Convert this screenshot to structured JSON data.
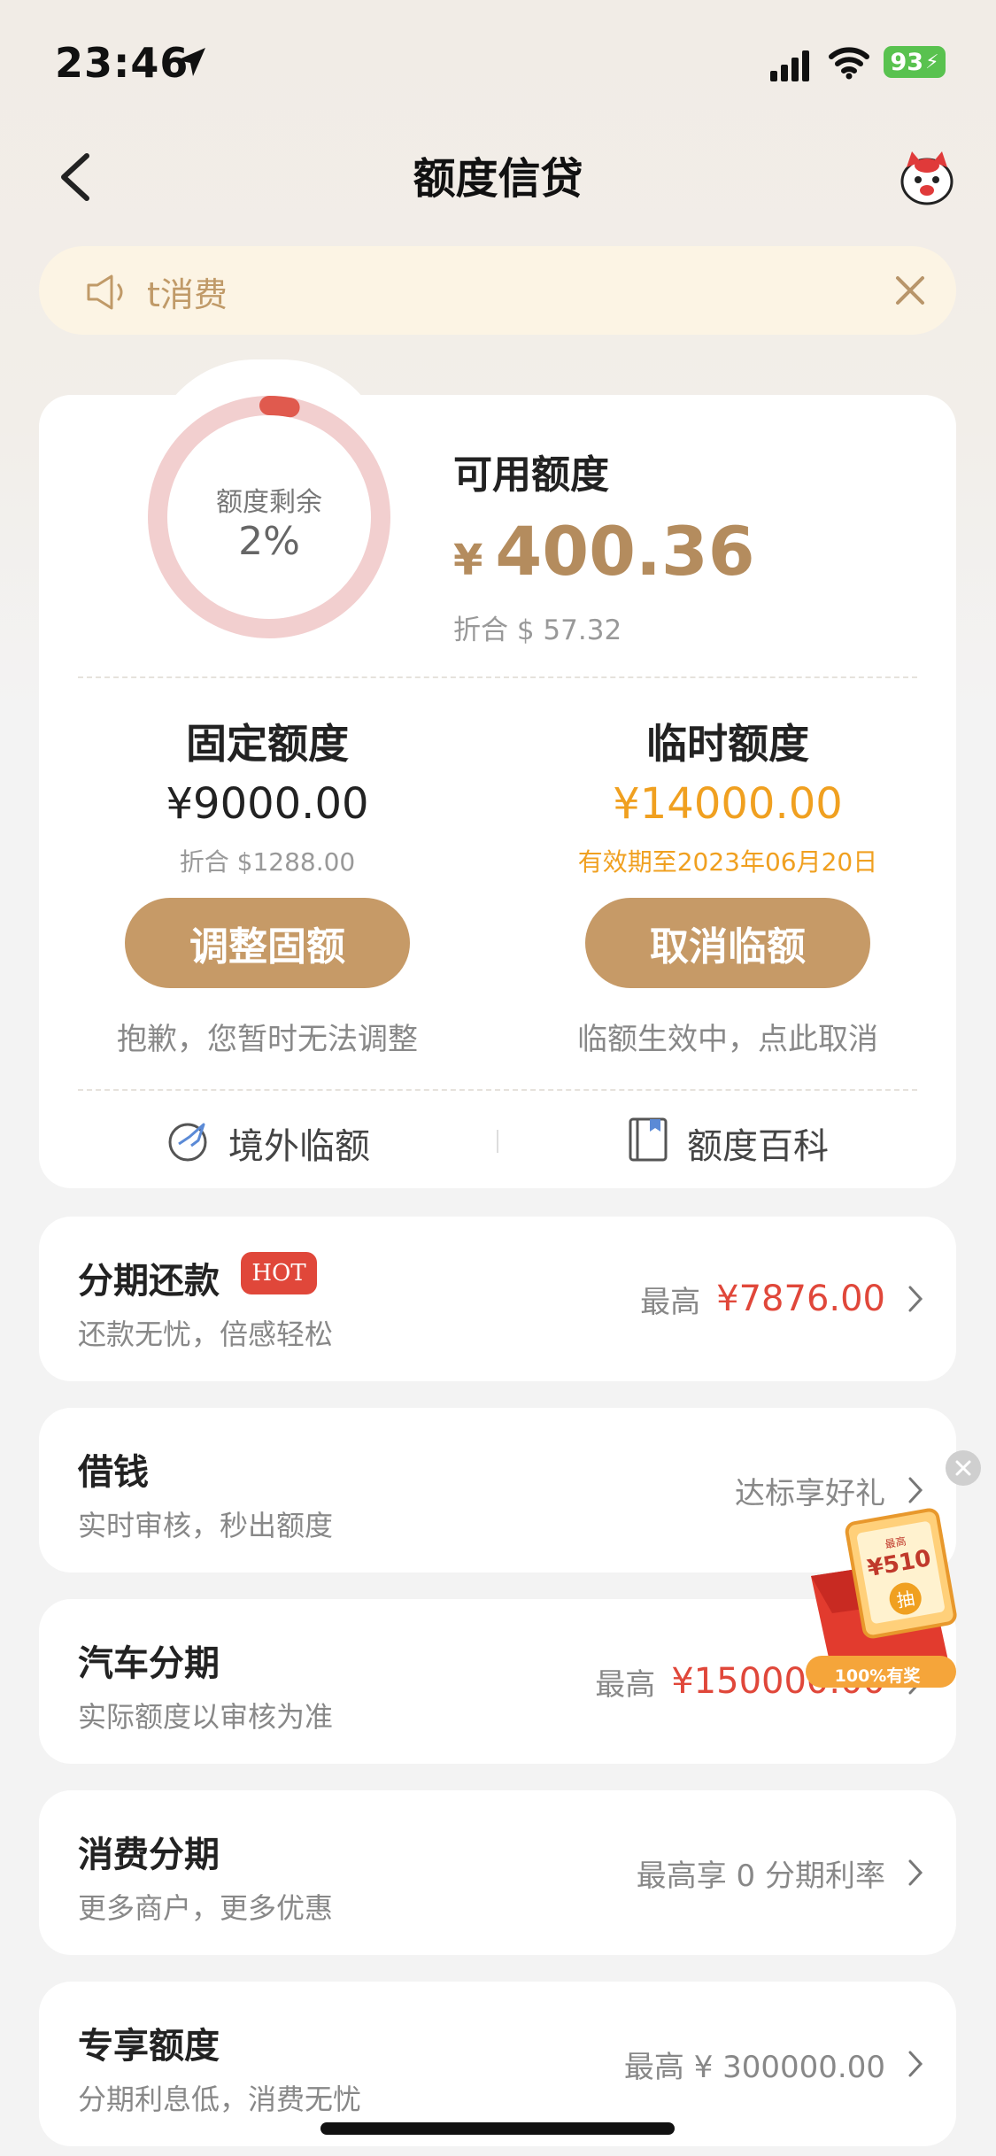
{
  "status_bar": {
    "time": "23:46",
    "battery": "93"
  },
  "nav": {
    "title": "额度信贷"
  },
  "notice": {
    "text": "t消费"
  },
  "quota": {
    "ring_label": "额度剩余",
    "ring_percent_text": "2%",
    "ring_fraction": 0.02,
    "available_title": "可用额度",
    "currency": "¥",
    "available_amount": "400.36",
    "available_conv": "折合 $ 57.32",
    "fixed": {
      "title": "固定额度",
      "amount": "¥9000.00",
      "conv": "折合 $1288.00",
      "button": "调整固额",
      "note": "抱歉，您暂时无法调整"
    },
    "temp": {
      "title": "临时额度",
      "amount": "¥14000.00",
      "validity": "有效期至2023年06月20日",
      "button": "取消临额",
      "note": "临额生效中，点此取消"
    },
    "links": {
      "overseas": "境外临额",
      "wiki": "额度百科"
    }
  },
  "products": [
    {
      "title": "分期还款",
      "badge": "HOT",
      "subtitle": "还款无忧，倍感轻松",
      "right_prefix": "最高",
      "right_value": "¥7876.00"
    },
    {
      "title": "借钱",
      "subtitle": "实时审核，秒出额度",
      "right_prefix": "达标享好礼",
      "right_value": ""
    },
    {
      "title": "汽车分期",
      "subtitle": "实际额度以审核为准",
      "right_prefix": "最高",
      "right_value": "¥150000.00"
    },
    {
      "title": "消费分期",
      "subtitle": "更多商户，更多优惠",
      "right_prefix": "最高享 0 分期利率",
      "right_value": ""
    },
    {
      "title": "专享额度",
      "subtitle": "分期利息低，消费无忧",
      "right_prefix": "最高 ¥ 300000.00",
      "right_value": ""
    }
  ],
  "promo": {
    "label": "100%有奖",
    "ticket_top": "最高",
    "ticket_amount": "¥510",
    "ticket_center": "抽"
  },
  "colors": {
    "gold": "#c69a67",
    "gold_text": "#b48c5e",
    "red": "#e0473a",
    "orange": "#f0a020",
    "ring_bg": "#f2cfcf",
    "ring_fg": "#e05a4e"
  }
}
